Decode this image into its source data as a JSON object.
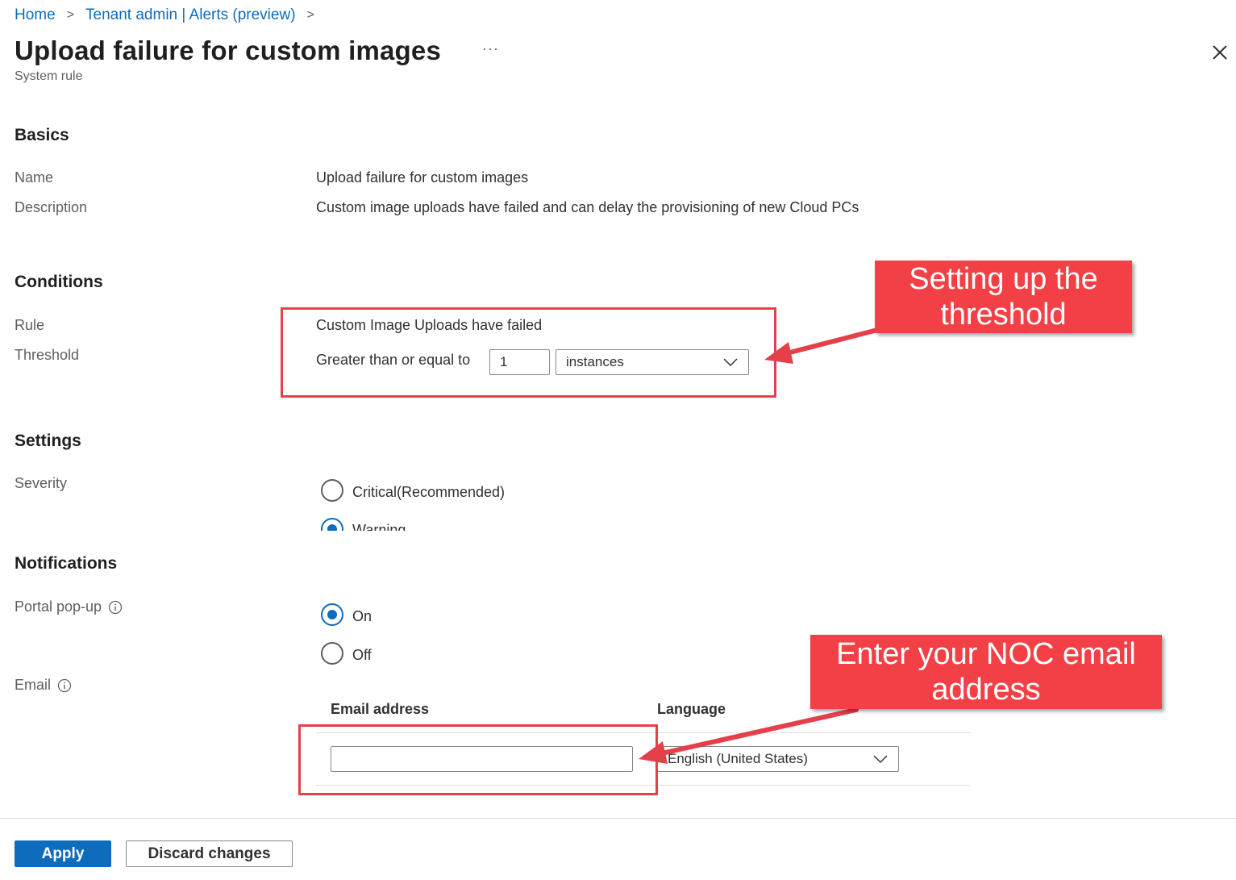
{
  "breadcrumb": {
    "home": "Home",
    "tenant": "Tenant admin | Alerts (preview)"
  },
  "header": {
    "title": "Upload failure for custom images",
    "subtitle": "System rule",
    "more": "···"
  },
  "basics": {
    "section": "Basics",
    "name_label": "Name",
    "name_value": "Upload failure for custom images",
    "description_label": "Description",
    "description_value": "Custom image uploads have failed and can delay the provisioning of new Cloud PCs"
  },
  "conditions": {
    "section": "Conditions",
    "rule_label": "Rule",
    "rule_value": "Custom Image Uploads have failed",
    "threshold_label": "Threshold",
    "threshold_text": "Greater than or equal to",
    "threshold_value": "1",
    "unit": "instances"
  },
  "settings": {
    "section": "Settings",
    "severity_label": "Severity",
    "options": [
      "Critical(Recommended)",
      "Warning"
    ],
    "selected": "Warning"
  },
  "notifications": {
    "section": "Notifications",
    "popup_label": "Portal pop-up",
    "popup_options": [
      "On",
      "Off"
    ],
    "popup_selected": "On",
    "email_label": "Email",
    "email_col": "Email address",
    "language_col": "Language",
    "email_value": "",
    "language_value": "English (United States)"
  },
  "callouts": {
    "threshold": "Setting up the threshold",
    "email": "Enter your NOC email address"
  },
  "footer": {
    "apply": "Apply",
    "discard": "Discard changes"
  },
  "colors": {
    "accent": "#0f6cbd",
    "callout": "#f24046",
    "highlight_border": "#e5404a"
  }
}
